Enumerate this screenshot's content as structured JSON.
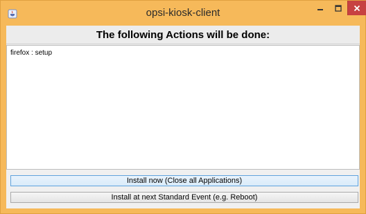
{
  "window": {
    "title": "opsi-kiosk-client",
    "icon": "java-cup-icon",
    "controls": {
      "minimize_icon": "minimize-icon",
      "maximize_icon": "maximize-icon",
      "close_icon": "close-icon"
    },
    "colors": {
      "frame": "#f6b95a",
      "close_button": "#c74141"
    }
  },
  "dialog": {
    "heading": "The following Actions will be done:",
    "actions": [
      "firefox : setup"
    ],
    "buttons": {
      "install_now": "Install now (Close all Applications)",
      "install_later": "Install at next Standard Event (e.g. Reboot)"
    }
  }
}
